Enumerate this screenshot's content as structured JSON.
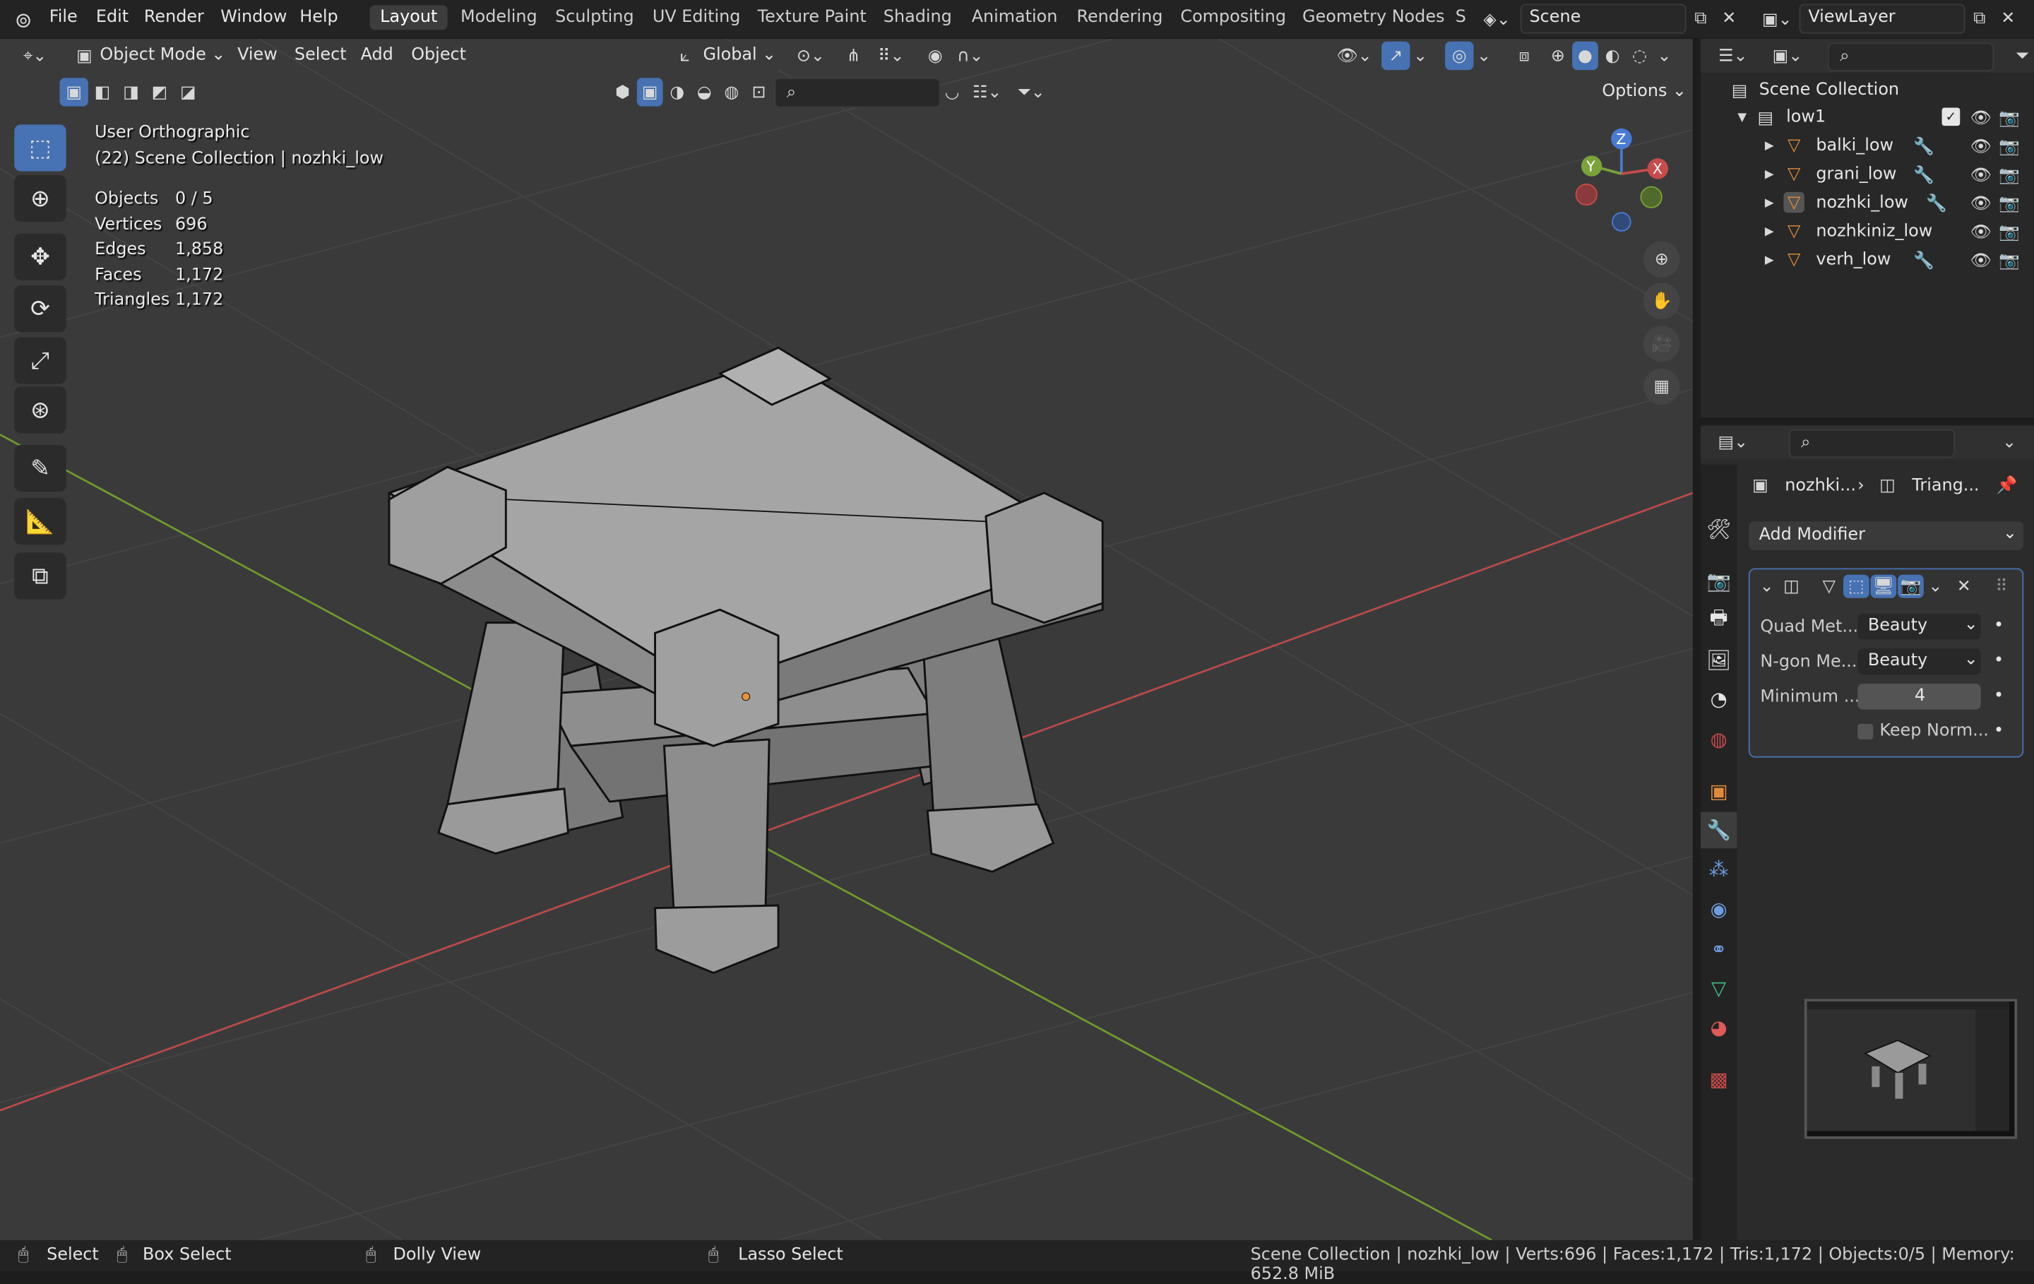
{
  "app": {
    "logo_icon": "blender-logo-icon"
  },
  "menus": [
    "File",
    "Edit",
    "Render",
    "Window",
    "Help"
  ],
  "workspaces": [
    "Layout",
    "Modeling",
    "Sculpting",
    "UV Editing",
    "Texture Paint",
    "Shading",
    "Animation",
    "Rendering",
    "Compositing",
    "Geometry Nodes",
    "S"
  ],
  "active_workspace": "Layout",
  "scene": {
    "value": "Scene"
  },
  "view_layer": {
    "value": "ViewLayer"
  },
  "viewport_header": {
    "mode": "Object Mode",
    "menus": [
      "View",
      "Select",
      "Add",
      "Object"
    ],
    "orientation": "Global",
    "options": "Options"
  },
  "overlay": {
    "view_name": "User Orthographic",
    "collection": "(22) Scene Collection | nozhki_low",
    "stats": [
      {
        "label": "Objects",
        "value": "0 / 5"
      },
      {
        "label": "Vertices",
        "value": "696"
      },
      {
        "label": "Edges",
        "value": "1,858"
      },
      {
        "label": "Faces",
        "value": "1,172"
      },
      {
        "label": "Triangles",
        "value": "1,172"
      }
    ]
  },
  "gizmo": {
    "x": "X",
    "y": "Y",
    "z": "Z"
  },
  "outliner": {
    "root": "Scene Collection",
    "collection": "low1",
    "objects": [
      {
        "name": "balki_low",
        "modifier": "wrench-icon"
      },
      {
        "name": "grani_low",
        "modifier": "wrench-icon"
      },
      {
        "name": "nozhki_low",
        "modifier": "wrench-icon"
      },
      {
        "name": "nozhkiniz_low",
        "modifier": ""
      },
      {
        "name": "verh_low",
        "modifier": "wrench-icon"
      }
    ]
  },
  "properties": {
    "breadcrumb_object": "nozhki...",
    "breadcrumb_modifier": "Triang...",
    "add_modifier": "Add Modifier",
    "fields": [
      {
        "label": "Quad Met...",
        "value": "Beauty"
      },
      {
        "label": "N-gon Me...",
        "value": "Beauty"
      },
      {
        "label": "Minimum ...",
        "value": "4"
      }
    ],
    "checkbox_label": "Keep Norm..."
  },
  "statusbar": {
    "select": "Select",
    "box_select": "Box Select",
    "dolly": "Dolly View",
    "lasso": "Lasso Select",
    "info": "Scene Collection | nozhki_low | Verts:696 | Faces:1,172 | Tris:1,172 | Objects:0/5 | Memory: 652.8 MiB"
  },
  "colors": {
    "accent": "#4772b3",
    "axis_x": "#c84b4b",
    "axis_y": "#7aa33a",
    "viewport_bg": "#3a3a3a",
    "object_orange": "#e08b3a"
  }
}
